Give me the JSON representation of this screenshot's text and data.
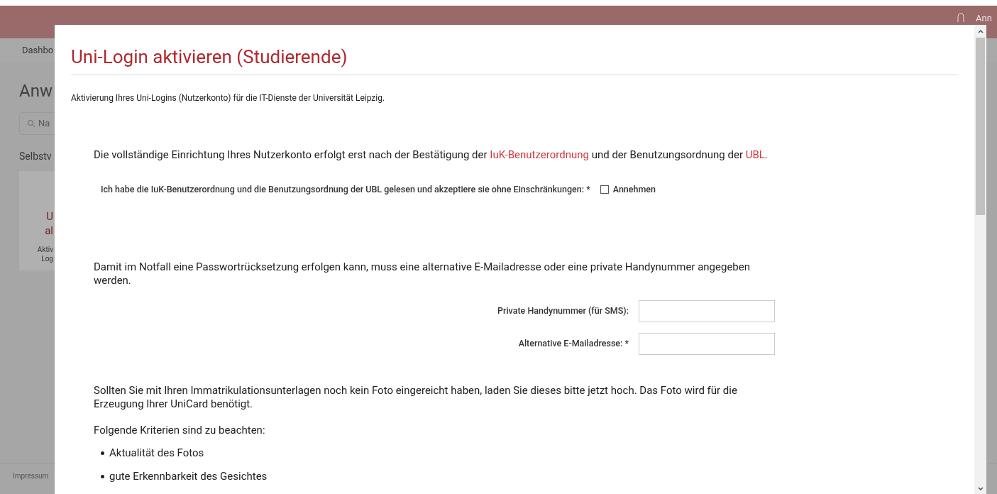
{
  "background": {
    "user_name": "Ann",
    "nav_item": "Dashbo",
    "page_title": "Anw",
    "search": {
      "placeholder": "Na"
    },
    "section_title": "Selbstv",
    "card": {
      "title_lines": [
        "U",
        "al"
      ],
      "description_lines": [
        "Aktiv",
        "Log"
      ]
    },
    "footer_link": "Impressum"
  },
  "dialog": {
    "title": "Uni-Login aktivieren (Studierende)",
    "intro": "Aktivierung Ihres Uni-Logins (Nutzerkonto) für die IT-Dienste der Universität Leipzig.",
    "terms_paragraph": [
      {
        "kind": "text",
        "text": "Die vollständige Einrichtung Ihres Nutzerkonto erfolgt erst nach der Bestätigung der "
      },
      {
        "kind": "link",
        "text": "IuK-Benutzerordnung"
      },
      {
        "kind": "text",
        "text": " und der Benutzungsordnung der "
      },
      {
        "kind": "link",
        "text": "UBL"
      },
      {
        "kind": "text",
        "text": "."
      }
    ],
    "accept": {
      "label": "Ich habe die IuK-Benutzerordnung und die Benutzungsordnung der UBL gelesen und akzeptiere sie ohne Einschränkungen: *",
      "option": "Annehmen",
      "checked": false
    },
    "recovery_paragraph": "Damit im Notfall eine Passwortrücksetzung erfolgen kann, muss eine alternative E-Mailadresse oder eine private Handynummer angegeben werden.",
    "fields": [
      {
        "label": "Private Handynummer (für SMS):"
      },
      {
        "label": "Alternative E-Mailadresse: *"
      }
    ],
    "photo_paragraph": "Sollten Sie mit Ihren Immatrikulationsunterlagen noch kein Foto eingereicht haben, laden Sie dieses bitte jetzt hoch. Das Foto wird für die Erzeugung Ihrer UniCard benötigt.",
    "criteria_title": "Folgende Kriterien sind zu beachten:",
    "criteria": [
      "Aktualität des Fotos",
      "gute Erkennbarkeit des Gesichtes"
    ]
  }
}
